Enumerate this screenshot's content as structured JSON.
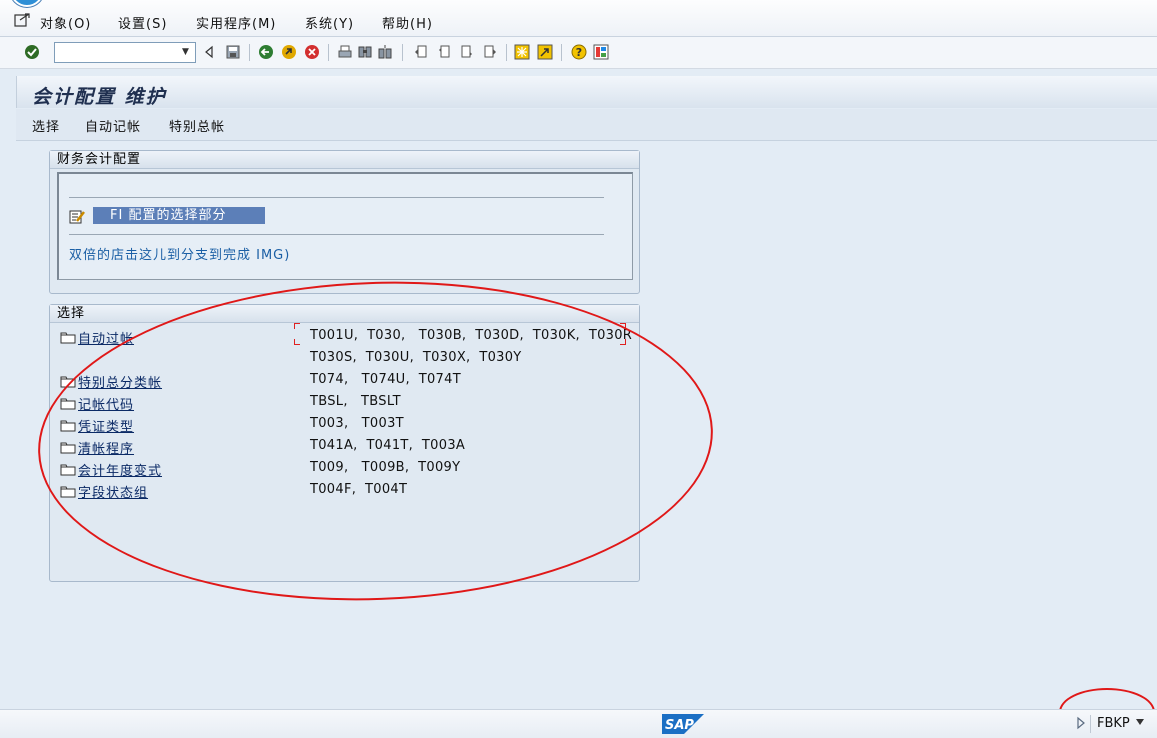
{
  "menu": {
    "items": [
      {
        "label": "对象(O)"
      },
      {
        "label": "设置(S)"
      },
      {
        "label": "实用程序(M)"
      },
      {
        "label": "系统(Y)"
      },
      {
        "label": "帮助(H)"
      }
    ]
  },
  "toolbar": {
    "command_field_value": "",
    "icons": [
      "enter-check-icon",
      "command-dropdown-icon",
      "back-triangle-icon",
      "save-icon",
      "back-icon",
      "exit-icon",
      "cancel-icon",
      "print-icon",
      "find-icon",
      "find-next-icon",
      "first-page-icon",
      "previous-page-icon",
      "next-page-icon",
      "last-page-icon",
      "create-session-icon",
      "shortcut-icon",
      "help-icon",
      "layout-icon"
    ]
  },
  "title": "会计配置 维护",
  "appbar": {
    "items": [
      {
        "label": "选择"
      },
      {
        "label": "自动记帐"
      },
      {
        "label": "特别总帐"
      }
    ]
  },
  "fi_group": {
    "title": "财务会计配置",
    "selected_label": "FI 配置的选择部分",
    "hint": "双倍的店击这儿到分支到完成 IMG)"
  },
  "selection_group": {
    "title": "选择",
    "rows": [
      {
        "label": "自动过帐",
        "tables": "T001U,  T030,   T030B,  T030D,  T030K,  T030R"
      },
      {
        "label": "",
        "tables": "T030S,  T030U,  T030X,  T030Y"
      },
      {
        "label": "特别总分类帐",
        "tables": "T074,   T074U,  T074T"
      },
      {
        "label": "记帐代码",
        "tables": "TBSL,   TBSLT"
      },
      {
        "label": "凭证类型",
        "tables": "T003,   T003T"
      },
      {
        "label": "清帐程序",
        "tables": "T041A,  T041T,  T003A"
      },
      {
        "label": "会计年度变式",
        "tables": "T009,   T009B,  T009Y"
      },
      {
        "label": "字段状态组",
        "tables": "T004F,  T004T"
      }
    ]
  },
  "statusbar": {
    "logo_text": "SAP",
    "transaction": "FBKP"
  },
  "colors": {
    "background": "#e3ecf5",
    "highlight": "#5c7fb8",
    "annotation": "#e01818",
    "link": "#0b2a66"
  }
}
